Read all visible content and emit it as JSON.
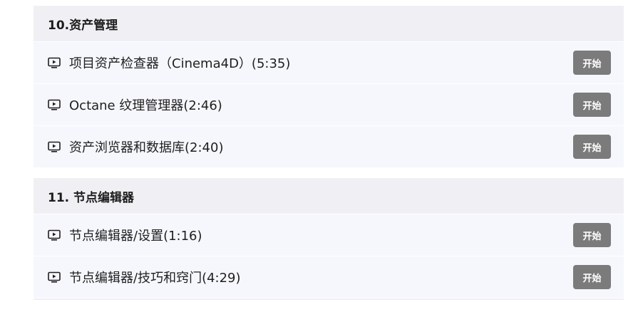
{
  "sections": [
    {
      "title": "10.资产管理",
      "lessons": [
        {
          "title": "项目资产检查器（Cinema4D）(5:35)",
          "button": "开始"
        },
        {
          "title": "Octane 纹理管理器(2:46)",
          "button": "开始"
        },
        {
          "title": "资产浏览器和数据库(2:40)",
          "button": "开始"
        }
      ]
    },
    {
      "title": "11. 节点编辑器",
      "lessons": [
        {
          "title": "节点编辑器/设置(1:16)",
          "button": "开始"
        },
        {
          "title": "节点编辑器/技巧和窍门(4:29)",
          "button": "开始"
        }
      ]
    }
  ],
  "icons": {
    "lesson": "video-play-icon"
  },
  "colors": {
    "header_bg": "#f0f0f4",
    "row_bg": "#f6f7fc",
    "button_bg": "#7b7b7b"
  }
}
